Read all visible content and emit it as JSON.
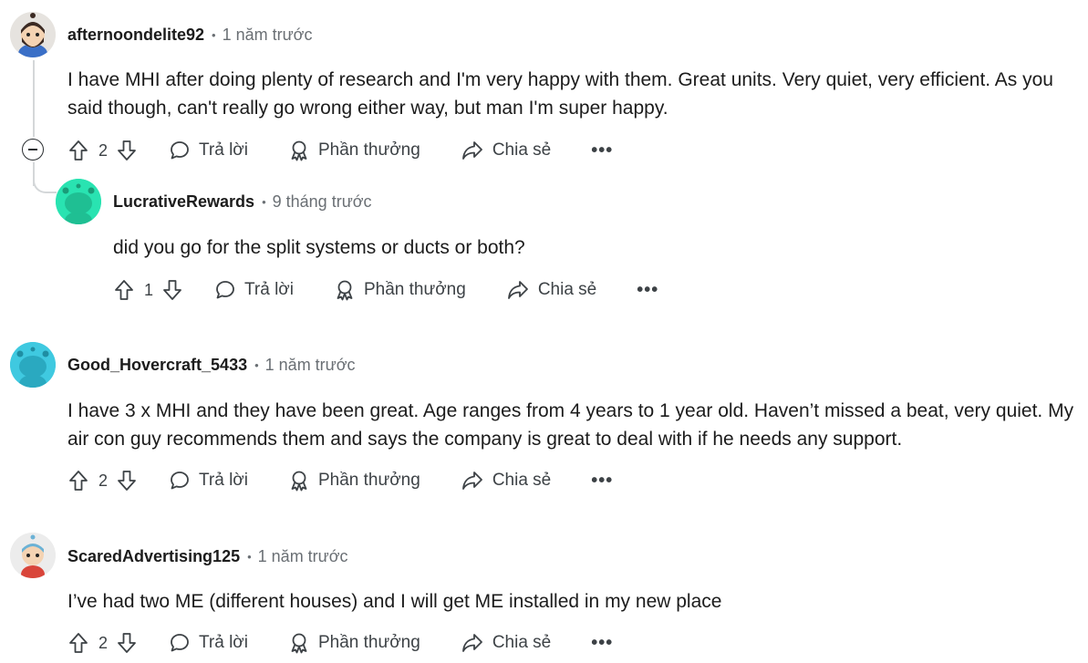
{
  "actions": {
    "reply_label": "Trả lời",
    "award_label": "Phần thưởng",
    "share_label": "Chia sẻ",
    "more_label": "•••"
  },
  "comments": [
    {
      "author": "afternoondelite92",
      "separator": "•",
      "time": "1 năm trước",
      "body": "I have MHI after doing plenty of research and I'm very happy with them. Great units. Very quiet, very efficient. As you said though, can't really go wrong either way, but man I'm super happy.",
      "score": "2",
      "avatar_color": "#f3f1ee"
    },
    {
      "author": "LucrativeRewards",
      "separator": "•",
      "time": "9 tháng trước",
      "body": "did you go for the split systems or ducts or both?",
      "score": "1",
      "avatar_color": "#29e3b1"
    },
    {
      "author": "Good_Hovercraft_5433",
      "separator": "•",
      "time": "1 năm trước",
      "body": "I have 3 x MHI and they have been great. Age ranges from 4 years to 1 year old. Haven’t missed a beat, very quiet. My air con guy recommends them and says the company is great to deal with if he needs any support.",
      "score": "2",
      "avatar_color": "#3fc9e0"
    },
    {
      "author": "ScaredAdvertising125",
      "separator": "•",
      "time": "1 năm trước",
      "body": "I’ve had two ME (different houses) and I will get ME installed in my new place",
      "score": "2",
      "avatar_color": "#e9e9e9"
    }
  ],
  "colors": {
    "text": "#1c1c1c",
    "meta": "#6a6f74",
    "thread_line": "#d4d7d9"
  }
}
